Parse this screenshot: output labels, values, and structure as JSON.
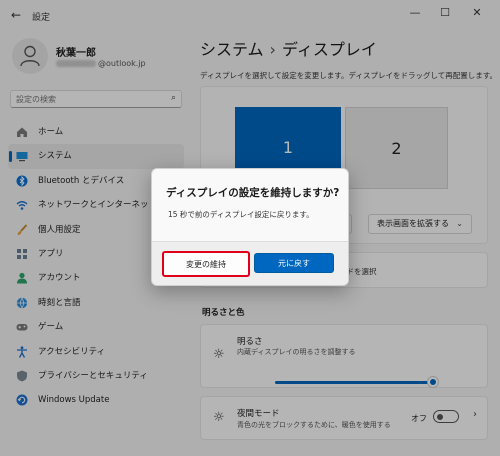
{
  "window": {
    "title": "設定",
    "back_glyph": "←",
    "minimize_glyph": "—",
    "maximize_glyph": "☐",
    "close_glyph": "✕"
  },
  "profile": {
    "name": "秋葉一郎",
    "email_suffix": "@outlook.jp"
  },
  "search": {
    "placeholder": "設定の検索",
    "icon": "search-icon",
    "icon_glyph": "⌕"
  },
  "sidebar": {
    "items": [
      {
        "label": "ホーム",
        "icon": "home-icon",
        "active": false
      },
      {
        "label": "システム",
        "icon": "monitor-icon",
        "active": true
      },
      {
        "label": "Bluetooth とデバイス",
        "icon": "bluetooth-icon",
        "active": false
      },
      {
        "label": "ネットワークとインターネット",
        "icon": "wifi-icon",
        "active": false
      },
      {
        "label": "個人用設定",
        "icon": "brush-icon",
        "active": false
      },
      {
        "label": "アプリ",
        "icon": "apps-icon",
        "active": false
      },
      {
        "label": "アカウント",
        "icon": "person-icon",
        "active": false
      },
      {
        "label": "時刻と言語",
        "icon": "globe-clock-icon",
        "active": false
      },
      {
        "label": "ゲーム",
        "icon": "gamepad-icon",
        "active": false
      },
      {
        "label": "アクセシビリティ",
        "icon": "accessibility-icon",
        "active": false
      },
      {
        "label": "プライバシーとセキュリティ",
        "icon": "shield-icon",
        "active": false
      },
      {
        "label": "Windows Update",
        "icon": "update-icon",
        "active": false
      }
    ]
  },
  "main": {
    "breadcrumb_parent": "システム",
    "breadcrumb_sep": "›",
    "breadcrumb_current": "ディスプレイ",
    "hint": "ディスプレイを選択して設定を変更します。ディスプレイをドラッグして再配置します。",
    "monitor1": "1",
    "monitor2": "2",
    "extend_label": "表示画面を拡張する",
    "chevron_glyph": "⌄",
    "below_text": "ードを選択",
    "section_brightness": "明るさと色",
    "brightness_title": "明るさ",
    "brightness_sub": "内蔵ディスプレイの明るさを調整する",
    "brightness_level": 0.95,
    "sun_glyph": "☼",
    "night_title": "夜間モード",
    "night_sub": "青色の光をブロックするために、暖色を使用する",
    "night_toggle_label": "オフ",
    "moon_glyph": "☼",
    "right_chevron": "›"
  },
  "dialog": {
    "title": "ディスプレイの設定を維持しますか?",
    "message": "15 秒で前のディスプレイ設定に戻ります。",
    "keep_label": "変更の維持",
    "revert_label": "元に戻す"
  },
  "colors": {
    "accent": "#0067c0",
    "highlight": "#e0001b"
  }
}
